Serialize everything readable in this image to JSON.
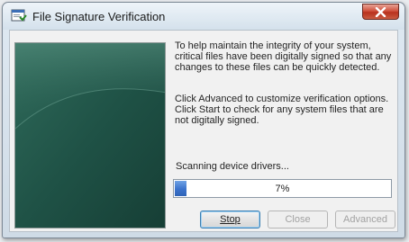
{
  "window": {
    "title": "File Signature Verification"
  },
  "description": {
    "paragraph1": "To help maintain the integrity of your system, critical files have been digitally signed so that any changes to these files can be quickly detected.",
    "paragraph2": "Click Advanced to customize verification options. Click Start to check for any system files that are not digitally signed."
  },
  "status": {
    "text": "Scanning device drivers...",
    "progress_percent": 7,
    "progress_label": "7%"
  },
  "buttons": {
    "stop": {
      "label": "Stop",
      "enabled": true
    },
    "close": {
      "label": "Close",
      "enabled": false
    },
    "advanced": {
      "label": "Advanced",
      "enabled": false
    }
  },
  "colors": {
    "panel_dark": "#1b4a40",
    "panel_mid": "#2d6657",
    "progress_fill": "#3a72cc"
  },
  "icons": [
    "app-window-icon",
    "close-icon"
  ]
}
